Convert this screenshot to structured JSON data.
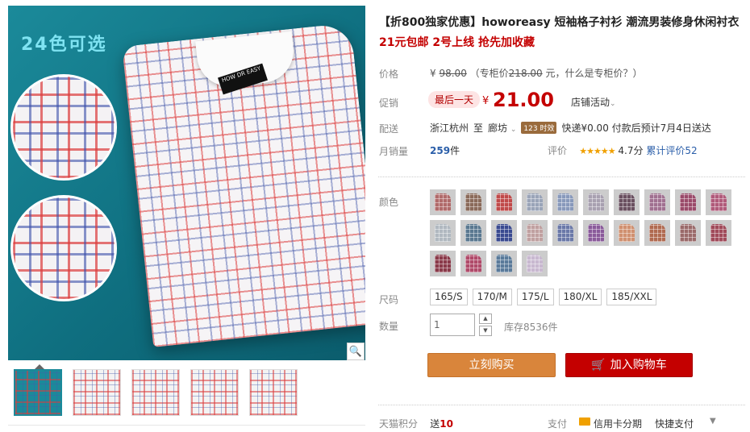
{
  "gallery": {
    "badge": "24色可选",
    "shirt_label": "HOW DR EASY",
    "zoom_icon": "magnifier-icon",
    "thumbnail_count": 5
  },
  "product": {
    "title": "【折800独家优惠】howoreasy 短袖格子衬衫 潮流男装修身休闲衬衣",
    "subtitle": "21元包邮 2号上线 抢先加收藏"
  },
  "price": {
    "label": "价格",
    "currency": "¥",
    "original": "98.00",
    "counter_prefix": "（专柜价",
    "counter_price": "218.00",
    "counter_suffix": "元，什么是专柜价？）"
  },
  "promo": {
    "label": "促销",
    "tag": "最后一天",
    "currency": "¥",
    "price": "21.00",
    "shop_promo": "店铺活动"
  },
  "shipping": {
    "label": "配送",
    "from": "浙江杭州",
    "to_word": "至",
    "to": "廊坊",
    "badge": "123 时效",
    "fee": "快递¥0.00 付款后预计7月4日送达"
  },
  "sales": {
    "label": "月销量",
    "count": "259",
    "unit": "件",
    "rating_label": "评价",
    "stars": "★★★★★",
    "score": "4.7分",
    "review_link": "累计评价52"
  },
  "color": {
    "label": "颜色",
    "swatches": [
      "#b06a6a",
      "#8a6a5a",
      "#c04a4a",
      "#9aa4b8",
      "#8899bb",
      "#a8a0b0",
      "#6a5060",
      "#a07090",
      "#9a4a6a",
      "#b05a7a",
      "#b0b8c0",
      "#5a7890",
      "#3a4a90",
      "#c0a0a0",
      "#6a78a8",
      "#8a5a9a",
      "#d09070",
      "#b06a50",
      "#9a6a6a",
      "#a04a5a",
      "#8a3a4a",
      "#b04a6a",
      "#5a7a9a",
      "#c8b8d0"
    ]
  },
  "size": {
    "label": "尺码",
    "options": [
      "165/S",
      "170/M",
      "175/L",
      "180/XL",
      "185/XXL"
    ]
  },
  "quantity": {
    "label": "数量",
    "value": "1",
    "stock": "库存8536件"
  },
  "actions": {
    "buy_now": "立刻购买",
    "add_to_cart": "加入购物车"
  },
  "points": {
    "label": "天猫积分",
    "send": "送",
    "amount": "10"
  },
  "payment": {
    "label": "支付",
    "credit": "信用卡分期",
    "quick": "快捷支付"
  }
}
